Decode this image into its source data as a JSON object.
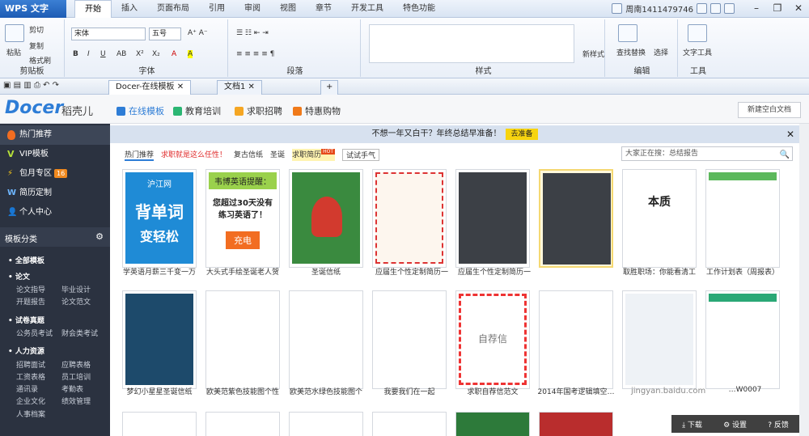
{
  "app": {
    "name": "WPS 文字",
    "user": "周南1411479746"
  },
  "menu": [
    "开始",
    "插入",
    "页面布局",
    "引用",
    "审阅",
    "视图",
    "章节",
    "开发工具",
    "特色功能"
  ],
  "ribbon": {
    "clipboard": {
      "label": "剪贴板",
      "paste": "粘贴",
      "cut": "剪切",
      "copy": "复制",
      "format": "格式刷"
    },
    "font": {
      "label": "字体",
      "name": "宋体",
      "size": "五号"
    },
    "paragraph": {
      "label": "段落"
    },
    "style": {
      "label": "样式",
      "new": "新样式"
    },
    "edit": {
      "label": "编辑",
      "find": "查找替换",
      "select": "选择"
    },
    "tools": {
      "label": "工具",
      "text_tool": "文字工具"
    }
  },
  "tabs": [
    {
      "label": "Docer-在线模板",
      "active": true
    },
    {
      "label": "文档1",
      "active": false
    }
  ],
  "docer": {
    "logo": "Docer",
    "logo_cn": "稻壳儿",
    "top_tabs": [
      "在线模板",
      "教育培训",
      "求职招聘",
      "特惠购物"
    ],
    "new_doc": "新建空白文档",
    "banner": {
      "text": "不想一年又白干？年终总结早准备！",
      "action": "去准备"
    },
    "filters": [
      "热门推荐",
      "求职就是这么任性！",
      "复古信纸",
      "圣诞",
      "求职简历",
      "试试手气"
    ],
    "search_placeholder": "大家正在搜：总结报告"
  },
  "sidebar": {
    "items": [
      {
        "label": "热门推荐"
      },
      {
        "label": "VIP模板"
      },
      {
        "label": "包月专区",
        "badge": "16"
      },
      {
        "label": "简历定制"
      },
      {
        "label": "个人中心"
      }
    ],
    "category_title": "模板分类",
    "groups": [
      {
        "head": "全部模板",
        "links": []
      },
      {
        "head": "论文",
        "links": [
          "论文指导",
          "毕业设计",
          "开题报告",
          "论文范文"
        ]
      },
      {
        "head": "试卷真题",
        "links": [
          "公务员考试",
          "财会类考试"
        ]
      },
      {
        "head": "人力资源",
        "links": [
          "招聘面试",
          "应聘表格",
          "工资表格",
          "员工培训",
          "通讯录",
          "考勤表",
          "企业文化",
          "绩效管理",
          "人事档案"
        ]
      }
    ]
  },
  "cards_row1": [
    "学英语月薪三千变一万",
    "大头式手绘圣诞老人贺",
    "圣诞信纸",
    "应届生个性定制简历一",
    "应届生个性定制简历一",
    "取胜职场：你能看清工",
    "工作计划表（周报表）"
  ],
  "cards_row2": [
    "梦幻小星星圣诞信纸",
    "欧美范紫色技能图个性",
    "欧美范水绿色技能图个",
    "我要我们在一起",
    "求职自荐信范文",
    "2014年国考逻辑填空…",
    "…W0007"
  ],
  "card_texts": {
    "hujiang": "沪江网",
    "word": "背单词",
    "easy": "变轻松",
    "ad": "韦博英语提醒：",
    "ad_body": "您超过30天没有练习英语了！",
    "charge": "充电",
    "letter": "自荐信",
    "fly": "本质"
  },
  "bottom": {
    "download": "下载",
    "settings": "设置",
    "feedback": "反馈"
  },
  "watermark": "jingyan.baidu.com"
}
